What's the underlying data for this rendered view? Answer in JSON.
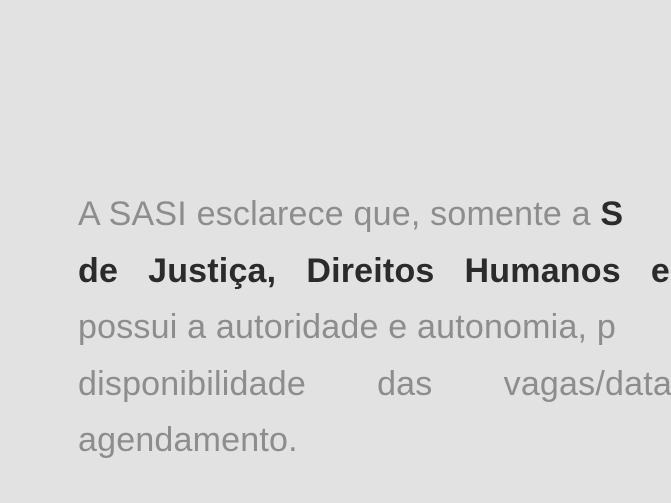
{
  "notice": {
    "line1_text": "A SASI esclarece que, somente a",
    "line1_strong": "S",
    "line2_words": [
      "de",
      "Justiça,",
      "Direitos",
      "Humanos",
      "e"
    ],
    "line3_text": "possui a autoridade e autonomia, p",
    "line4_words": [
      "disponibilidade",
      "das",
      "vagas/data"
    ],
    "line5_text": "agendamento."
  }
}
